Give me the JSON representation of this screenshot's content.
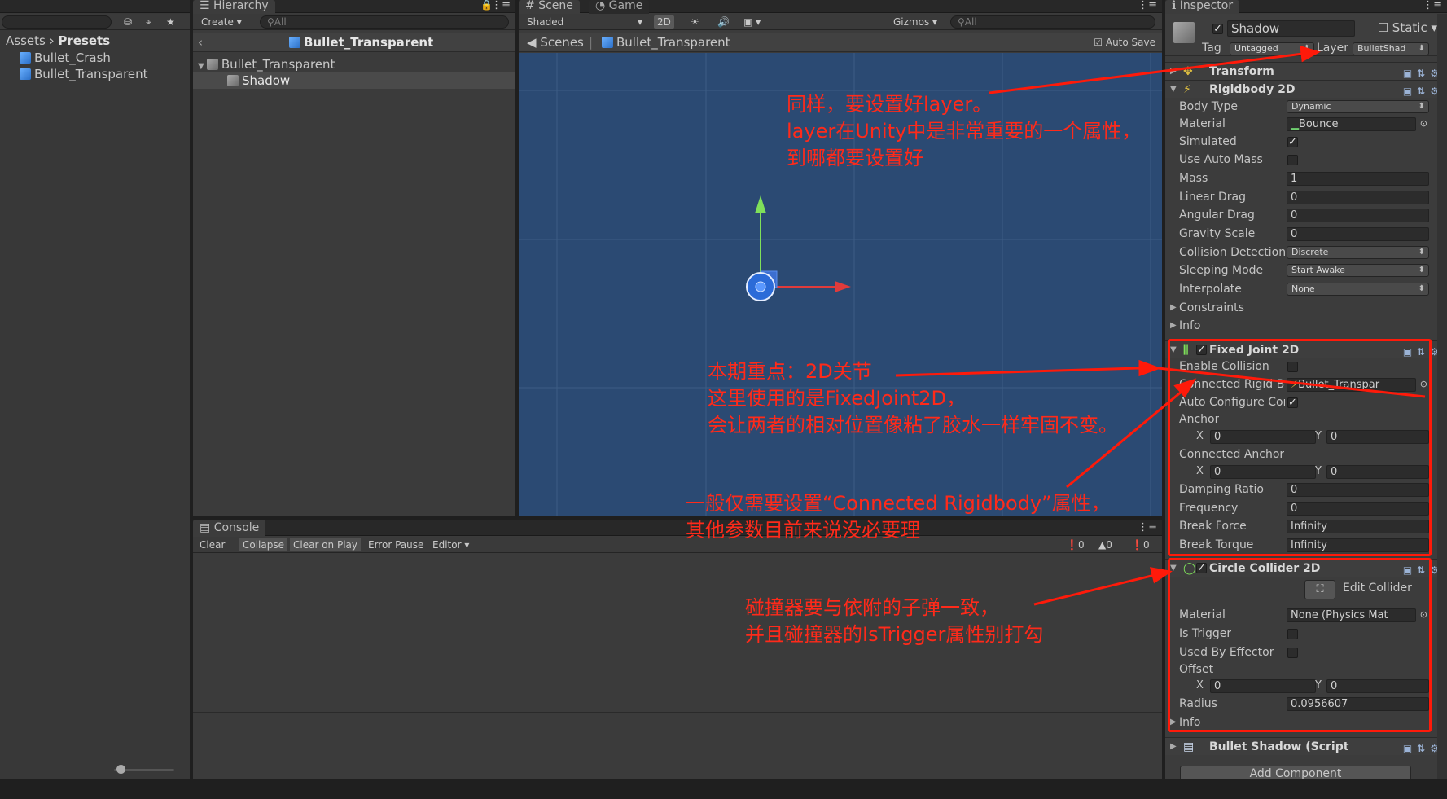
{
  "project": {
    "breadcrumb_root": "Assets",
    "breadcrumb_leaf": "Presets",
    "assets": [
      "Bullet_Crash",
      "Bullet_Transparent"
    ]
  },
  "hierarchy": {
    "tab": "Hierarchy",
    "create": "Create",
    "search_placeholder": "All",
    "prefab_title": "Bullet_Transparent",
    "items": [
      "Bullet_Transparent",
      "Shadow"
    ]
  },
  "scene": {
    "tab_scene": "Scene",
    "tab_game": "Game",
    "shading": "Shaded",
    "mode_2d": "2D",
    "gizmos": "Gizmos",
    "search_placeholder": "All",
    "breadcrumb_root": "Scenes",
    "breadcrumb_leaf": "Bullet_Transparent",
    "auto_save": "Auto Save"
  },
  "console": {
    "tab": "Console",
    "buttons": [
      "Clear",
      "Collapse",
      "Clear on Play",
      "Error Pause",
      "Editor"
    ],
    "counts": [
      "0",
      "0",
      "0"
    ]
  },
  "inspector": {
    "tab": "Inspector",
    "object_name": "Shadow",
    "static_label": "Static",
    "tag_label": "Tag",
    "tag_value": "Untagged",
    "layer_label": "Layer",
    "layer_value": "BulletShad",
    "transform": "Transform",
    "rigidbody": {
      "title": "Rigidbody 2D",
      "body_type_label": "Body Type",
      "body_type": "Dynamic",
      "material_label": "Material",
      "material": "Bounce",
      "simulated_label": "Simulated",
      "auto_mass_label": "Use Auto Mass",
      "mass_label": "Mass",
      "mass": "1",
      "linear_drag_label": "Linear Drag",
      "linear_drag": "0",
      "angular_drag_label": "Angular Drag",
      "angular_drag": "0",
      "gravity_label": "Gravity Scale",
      "gravity": "0",
      "collision_label": "Collision Detection",
      "collision": "Discrete",
      "sleeping_label": "Sleeping Mode",
      "sleeping": "Start Awake",
      "interpolate_label": "Interpolate",
      "interpolate": "None",
      "constraints_label": "Constraints",
      "info_label": "Info"
    },
    "fixed_joint": {
      "title": "Fixed Joint 2D",
      "enable_collision_label": "Enable Collision",
      "connected_label": "Connected Rigid Bod",
      "connected_value": "Bullet_Transpar",
      "auto_configure_label": "Auto Configure Conr",
      "anchor_label": "Anchor",
      "anchor_x": "0",
      "anchor_y": "0",
      "connected_anchor_label": "Connected Anchor",
      "connected_anchor_x": "0",
      "connected_anchor_y": "0",
      "damping_label": "Damping Ratio",
      "damping": "0",
      "frequency_label": "Frequency",
      "frequency": "0",
      "break_force_label": "Break Force",
      "break_force": "Infinity",
      "break_torque_label": "Break Torque",
      "break_torque": "Infinity",
      "x_label": "X",
      "y_label": "Y"
    },
    "circle_collider": {
      "title": "Circle Collider 2D",
      "edit_collider": "Edit Collider",
      "material_label": "Material",
      "material": "None (Physics Mat",
      "trigger_label": "Is Trigger",
      "effector_label": "Used By Effector",
      "offset_label": "Offset",
      "offset_x": "0",
      "offset_y": "0",
      "radius_label": "Radius",
      "radius": "0.0956607",
      "info_label": "Info"
    },
    "script_title": "Bullet Shadow (Script",
    "add_component": "Add Component"
  },
  "annotations": {
    "a1": [
      "同样，要设置好layer。",
      "layer在Unity中是非常重要的一个属性，",
      "到哪都要设置好"
    ],
    "a2": [
      "本期重点：2D关节",
      "这里使用的是FixedJoint2D，",
      "会让两者的相对位置像粘了胶水一样牢固不变。"
    ],
    "a3": [
      "一般仅需要设置“Connected Rigidbody”属性，",
      "其他参数目前来说没必要理"
    ],
    "a4": [
      "碰撞器要与依附的子弹一致，",
      "并且碰撞器的IsTrigger属性别打勾"
    ]
  },
  "colors": {
    "annotation": "#ff2a1a",
    "scene_bg": "#2a4a73",
    "accent": "#3e7ce0"
  }
}
